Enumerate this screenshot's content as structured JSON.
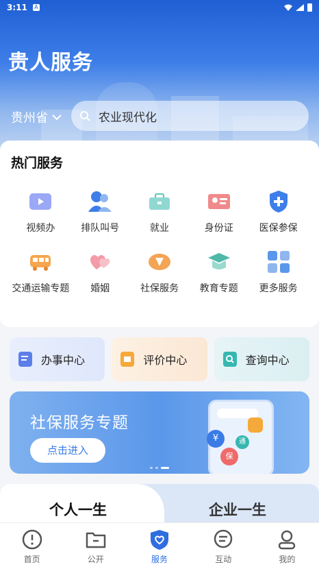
{
  "status_bar": {
    "time": "3:11",
    "badge": "A"
  },
  "header": {
    "title": "贵人服务",
    "region": "贵州省",
    "search_value": "农业现代化"
  },
  "hot_services": {
    "title": "热门服务",
    "items": [
      {
        "label": "视频办",
        "icon": "video-icon"
      },
      {
        "label": "排队叫号",
        "icon": "queue-icon"
      },
      {
        "label": "就业",
        "icon": "briefcase-icon"
      },
      {
        "label": "身份证",
        "icon": "id-card-icon"
      },
      {
        "label": "医保参保",
        "icon": "medical-shield-icon"
      },
      {
        "label": "交通运输专题",
        "icon": "bus-icon"
      },
      {
        "label": "婚姻",
        "icon": "hearts-icon"
      },
      {
        "label": "社保服务",
        "icon": "social-security-icon"
      },
      {
        "label": "教育专题",
        "icon": "graduation-cap-icon"
      },
      {
        "label": "更多服务",
        "icon": "grid-more-icon"
      }
    ]
  },
  "centers": [
    {
      "label": "办事中心",
      "icon": "document-edit-icon",
      "color": "#5b7ee8"
    },
    {
      "label": "评价中心",
      "icon": "rating-icon",
      "color": "#f5a93a"
    },
    {
      "label": "查询中心",
      "icon": "search-doc-icon",
      "color": "#36b7b0"
    }
  ],
  "banner": {
    "title": "社保服务专题",
    "button": "点击进入",
    "badge_yuan": "¥",
    "badge_bao": "保",
    "badge_tong": "通"
  },
  "life_tabs": {
    "personal": "个人一生",
    "enterprise": "企业一生"
  },
  "bottom_nav": {
    "items": [
      {
        "label": "首页",
        "icon": "home-icon"
      },
      {
        "label": "公开",
        "icon": "folder-icon"
      },
      {
        "label": "服务",
        "icon": "service-heart-icon",
        "active": true
      },
      {
        "label": "互动",
        "icon": "chat-icon"
      },
      {
        "label": "我的",
        "icon": "user-icon"
      }
    ]
  },
  "colors": {
    "primary": "#2f6ee0",
    "hero_top": "#1f5fd4"
  }
}
